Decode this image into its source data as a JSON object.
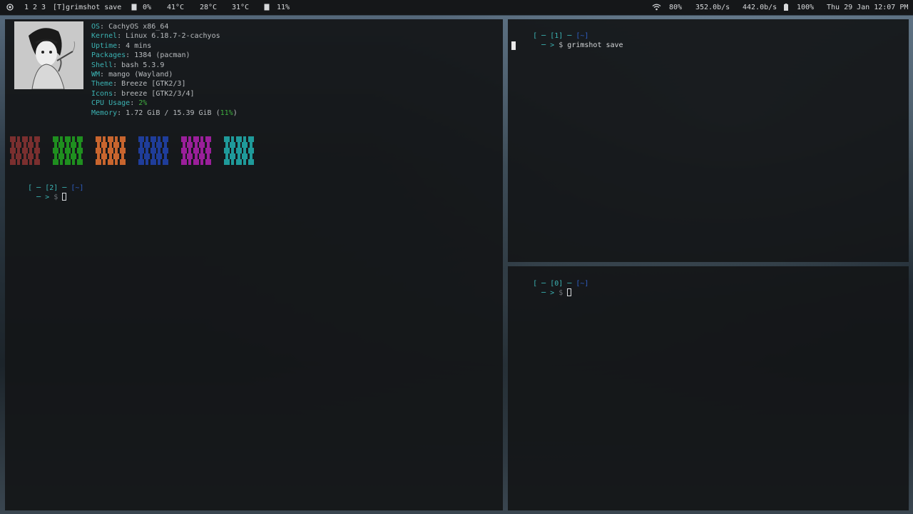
{
  "topbar": {
    "workspaces": [
      "1",
      "2",
      "3"
    ],
    "window_title": "[T]grimshot save",
    "cpu": "0%",
    "temps": [
      "41°C",
      "28°C",
      "31°C"
    ],
    "mem": "11%",
    "wifi": "80%",
    "net_down": "352.0b/s",
    "net_up": "442.0b/s",
    "battery": "100%",
    "clock": "Thu 29 Jan 12:07 PM"
  },
  "left_terminal": {
    "fastfetch": [
      {
        "key": "OS",
        "value": "CachyOS x86_64"
      },
      {
        "key": "Kernel",
        "value": "Linux 6.18.7-2-cachyos"
      },
      {
        "key": "Uptime",
        "value": "4 mins"
      },
      {
        "key": "Packages",
        "value": "1384 (pacman)"
      },
      {
        "key": "Shell",
        "value": "bash 5.3.9"
      },
      {
        "key": "WM",
        "value": "mango (Wayland)"
      },
      {
        "key": "Theme",
        "value": "Breeze [GTK2/3]"
      },
      {
        "key": "Icons",
        "value": "breeze [GTK2/3/4]"
      },
      {
        "key": "CPU Usage",
        "value": "2%"
      },
      {
        "key": "Memory",
        "value": "1.72 GiB / 15.39 GiB (",
        "extra": "11%",
        "tail": ")"
      }
    ],
    "palette": [
      "#7a2f2f",
      "#1f8f1f",
      "#c8652e",
      "#1f3d9a",
      "#9a1f9a",
      "#1f9a9a"
    ],
    "prompt": {
      "num": "[2]",
      "dir": "[~]",
      "symbol": "$",
      "arrow": "─ >",
      "bracket": "[",
      "dash": "─"
    }
  },
  "top_right_terminal": {
    "prompt": {
      "num": "[1]",
      "dir": "[~]",
      "symbol": "$",
      "command": "grimshot save",
      "arrow": "─ >",
      "bracket": "[",
      "dash": "─"
    }
  },
  "bottom_right_terminal": {
    "prompt": {
      "num": "[0]",
      "dir": "[~]",
      "symbol": "$",
      "arrow": "─ >",
      "bracket": "[",
      "dash": "─"
    }
  }
}
